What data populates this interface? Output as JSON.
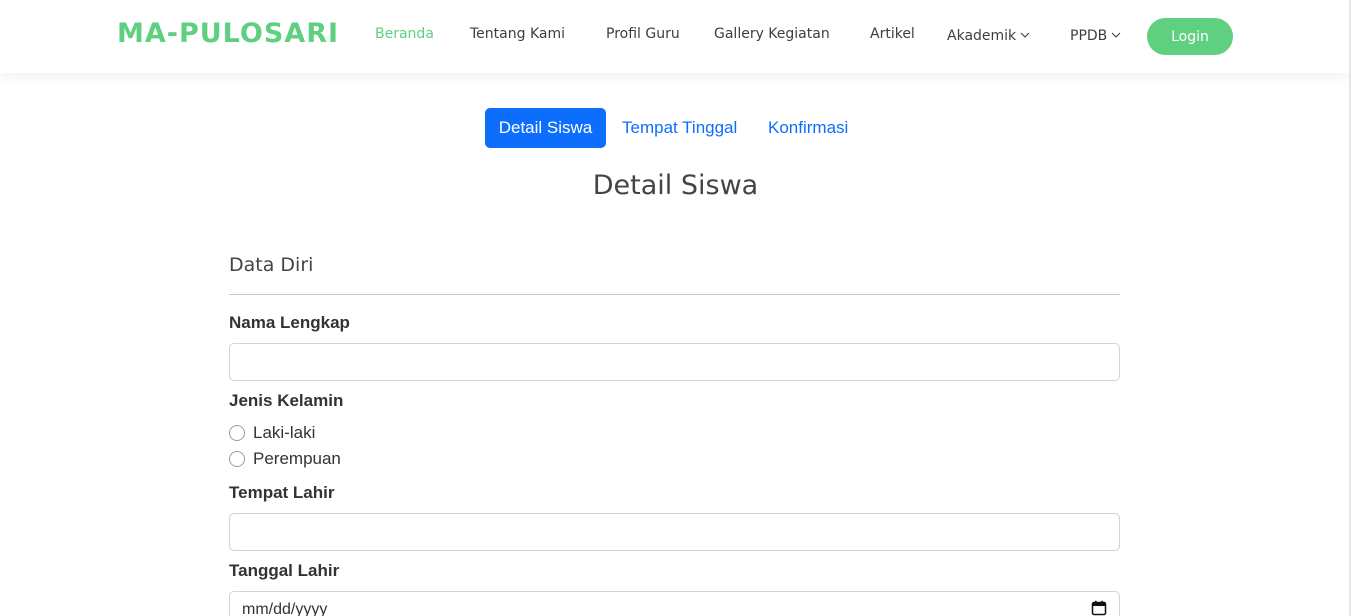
{
  "header": {
    "logo": "MA-PULOSARI",
    "nav": [
      {
        "label": "Beranda"
      },
      {
        "label": "Tentang Kami"
      },
      {
        "label": "Profil Guru"
      },
      {
        "label": "Gallery Kegiatan"
      },
      {
        "label": "Artikel"
      },
      {
        "label": "Akademik"
      },
      {
        "label": "PPDB"
      }
    ],
    "login_label": "Login"
  },
  "steps": [
    {
      "label": "Detail Siswa"
    },
    {
      "label": "Tempat Tinggal"
    },
    {
      "label": "Konfirmasi"
    }
  ],
  "form": {
    "title": "Detail Siswa",
    "section": "Data Diri",
    "nama_label": "Nama Lengkap",
    "nama_value": "",
    "jenis_label": "Jenis Kelamin",
    "gender_options": [
      {
        "label": "Laki-laki"
      },
      {
        "label": "Perempuan"
      }
    ],
    "tempat_label": "Tempat Lahir",
    "tempat_value": "",
    "tanggal_label": "Tanggal Lahir",
    "tanggal_placeholder": "mm/dd/yyyy"
  },
  "colors": {
    "brand_green": "#5fcf80",
    "primary_blue": "#0d6efd"
  },
  "icons": [
    "chevron-down-icon",
    "calendar-icon"
  ]
}
